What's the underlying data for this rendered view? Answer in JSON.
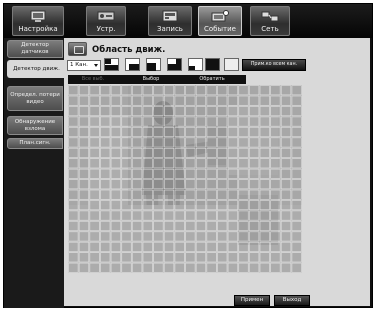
{
  "nav": {
    "tabs": [
      {
        "label": "Настройка",
        "icon": "settings-icon"
      },
      {
        "label": "Устр.",
        "icon": "device-icon"
      },
      {
        "label": "Запись",
        "icon": "record-icon"
      },
      {
        "label": "Событие",
        "icon": "event-icon"
      },
      {
        "label": "Сеть",
        "icon": "network-icon"
      }
    ],
    "active_tab": "Событие"
  },
  "sidebar": {
    "items": [
      {
        "label": "Детектор датчиков"
      },
      {
        "label": "Детектор движ."
      },
      {
        "label": "Определ. потери видео"
      },
      {
        "label": "Обнаружение взлома"
      },
      {
        "label": "План.сигн."
      }
    ],
    "active_item": "Детектор движ."
  },
  "main": {
    "title": "Область движ.",
    "title_icon": "motion-area-icon",
    "channel": {
      "value": "1 Кан."
    },
    "apply_all_label": "Прим.ко всем кан.",
    "toolbar": {
      "all_label": "Все выб.",
      "select_label": "Выбор",
      "invert_label": "Обратить"
    },
    "grid": {
      "columns": 22,
      "rows": 18,
      "all_cells_selected": true
    },
    "apply_label": "Примен",
    "exit_label": "Выход"
  },
  "colors": {
    "background": "#0f0f0f",
    "panel": "#d9d9d9",
    "grid_cell": "#9a9a9a",
    "grid_line": "#dcdcdc"
  }
}
